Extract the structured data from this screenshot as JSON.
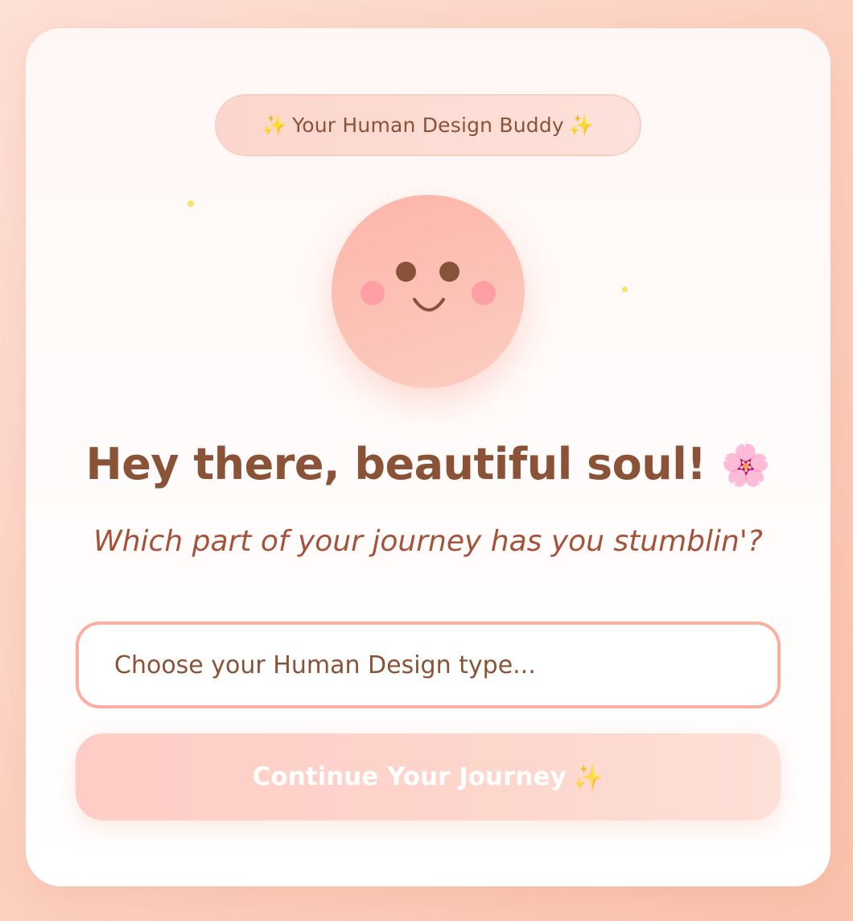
{
  "badge": {
    "sparkle_left": "✨",
    "label": "Your Human Design Buddy",
    "sparkle_right": "✨"
  },
  "mascot": {
    "icon": "smiley-face-icon"
  },
  "greeting": {
    "title": "Hey there, beautiful soul!",
    "emoji": "🌸",
    "subtitle": "Which part of your journey has you stumblin'?"
  },
  "type_select": {
    "placeholder": "Choose your Human Design type..."
  },
  "continue_button": {
    "label": "Continue Your Journey",
    "sparkle": "✨"
  },
  "colors": {
    "brown_text": "#8a5236",
    "accent_pink": "#fbaea2",
    "face": "#fdb5a8",
    "cheek": "#fd9fa5",
    "sparkle_dot": "#f7df6a"
  }
}
